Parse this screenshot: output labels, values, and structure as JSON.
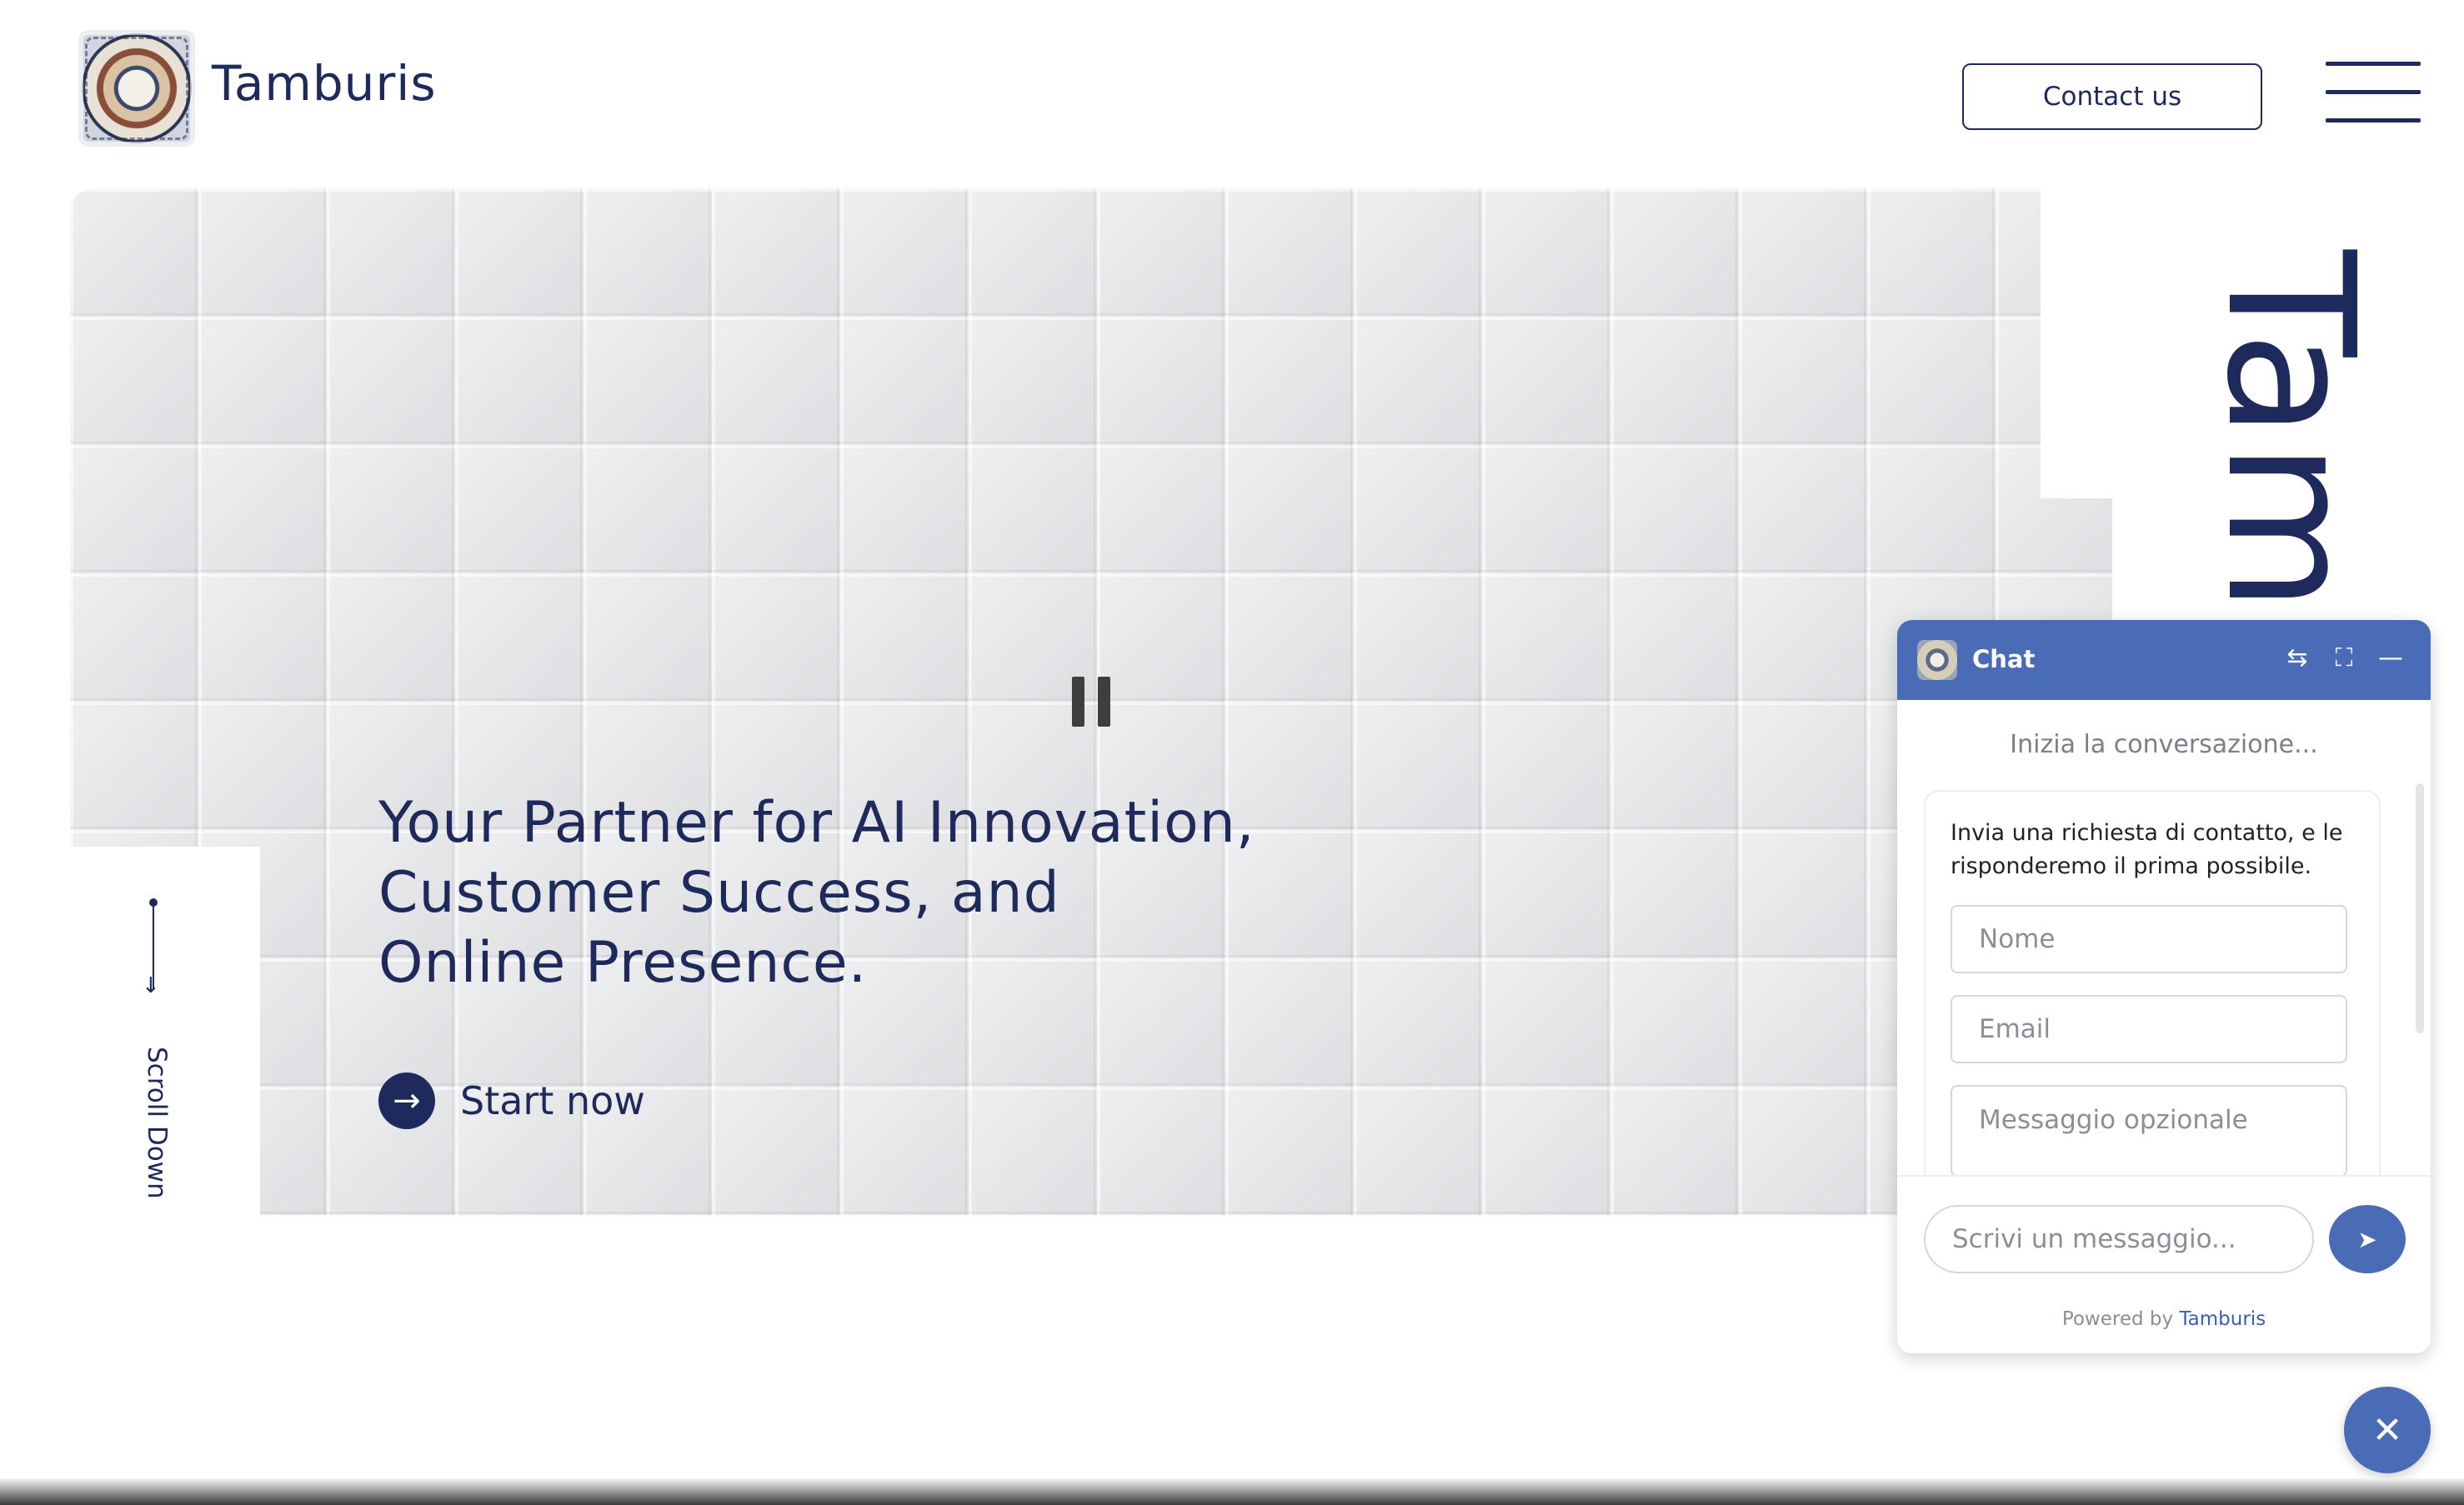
{
  "header": {
    "brand": "Tamburis",
    "contact_label": "Contact us"
  },
  "hero": {
    "headline_lines": [
      "Your Partner for AI Innovation,",
      "Customer Success, and",
      "Online Presence."
    ],
    "cta_label": "Start now",
    "scroll_label": "Scroll Down",
    "vertical_brand": "Tamburis"
  },
  "chat": {
    "title": "Chat",
    "start_text": "Inizia la conversazione...",
    "card_text": "Invia una richiesta di contatto, e le risponderemo il prima possibile.",
    "name_placeholder": "Nome",
    "email_placeholder": "Email",
    "message_placeholder": "Messaggio opzionale",
    "input_placeholder": "Scrivi un messaggio...",
    "powered_by": "Powered by",
    "powered_brand": "Tamburis"
  },
  "colors": {
    "navy": "#1f2a5c",
    "chat_blue": "#4a6cb6"
  },
  "icons": [
    "logo",
    "hamburger-menu-icon",
    "pause-icon",
    "arrow-right-icon",
    "scroll-arrow-icon",
    "sidebar-toggle-icon",
    "expand-icon",
    "minimize-icon",
    "send-icon",
    "close-icon"
  ]
}
